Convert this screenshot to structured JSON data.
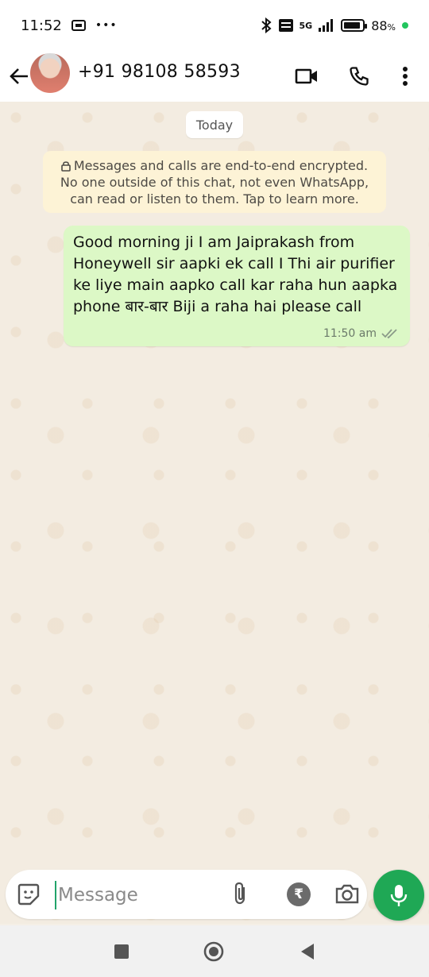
{
  "status_bar": {
    "time": "11:52",
    "more_dots": "•••",
    "network": "5G",
    "battery_percent": "88",
    "battery_unit": "%"
  },
  "header": {
    "contact": "+91 98108 58593"
  },
  "chat": {
    "date_chip": "Today",
    "encryption_notice": "Messages and calls are end-to-end encrypted. No one outside of this chat, not even WhatsApp, can read or listen to them. Tap to learn more.",
    "messages": [
      {
        "text": "Good morning ji I am Jaiprakash from Honeywell sir aapki ek call I Thi air purifier ke liye main aapko call kar raha hun aapka phone बार-बार Biji a raha hai please call",
        "time": "11:50 am",
        "status": "delivered"
      }
    ]
  },
  "input_bar": {
    "placeholder": "Message",
    "rupee_symbol": "₹"
  },
  "colors": {
    "bubble_out": "#dcf8c6",
    "encryption_bg": "#fdf3d6",
    "accent_green": "#1fa855"
  },
  "icons": {
    "back": "arrow-left-icon",
    "video": "video-call-icon",
    "call": "phone-icon",
    "menu": "more-vertical-icon",
    "sticker": "sticker-icon",
    "attach": "paperclip-icon",
    "payment": "rupee-icon",
    "camera": "camera-icon",
    "mic": "mic-icon"
  }
}
